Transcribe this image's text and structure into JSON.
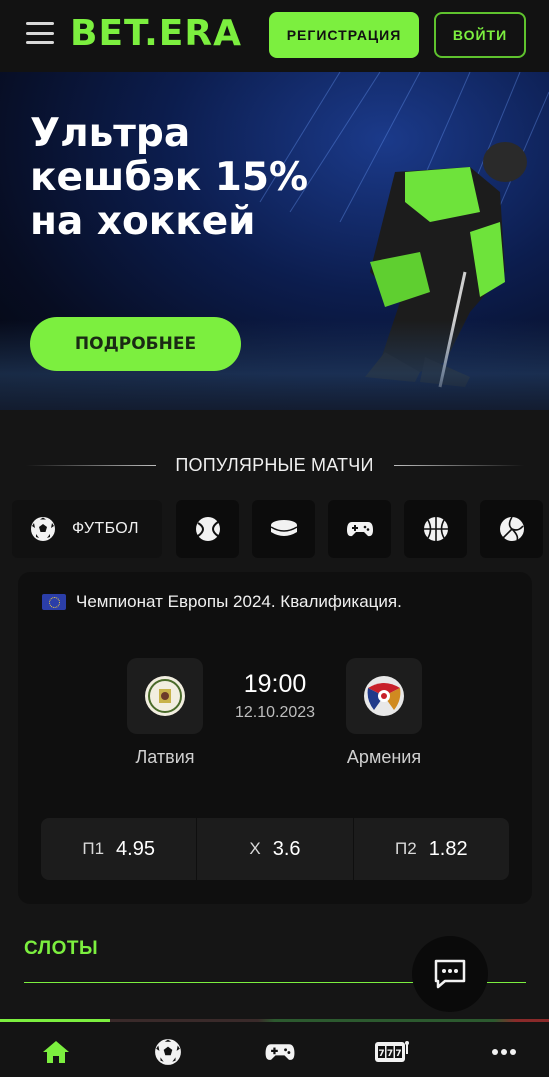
{
  "header": {
    "logo_text": "BET.ERA",
    "register_label": "РЕГИСТРАЦИЯ",
    "login_label": "ВОЙТИ",
    "accent_color": "#7cef3f"
  },
  "banner": {
    "title": "Ультра\nкешбэк 15%\nна хоккей",
    "button_label": "ПОДРОБНЕЕ"
  },
  "popular": {
    "title": "ПОПУЛЯРНЫЕ МАТЧИ",
    "tabs": [
      {
        "icon": "soccer-ball-icon",
        "label": "ФУТБОЛ",
        "active": true
      },
      {
        "icon": "tennis-ball-icon",
        "label": ""
      },
      {
        "icon": "hockey-puck-icon",
        "label": ""
      },
      {
        "icon": "gamepad-icon",
        "label": ""
      },
      {
        "icon": "basketball-icon",
        "label": ""
      },
      {
        "icon": "volleyball-icon",
        "label": ""
      }
    ]
  },
  "match": {
    "league": "Чемпионат Европы 2024. Квалификация.",
    "time": "19:00",
    "date": "12.10.2023",
    "home_team": "Латвия",
    "away_team": "Армения",
    "odds": [
      {
        "label": "П1",
        "value": "4.95"
      },
      {
        "label": "Х",
        "value": "3.6"
      },
      {
        "label": "П2",
        "value": "1.82"
      }
    ]
  },
  "slots": {
    "title": "СЛОТЫ"
  },
  "bottom_nav": [
    {
      "icon": "home-icon"
    },
    {
      "icon": "soccer-ball-icon"
    },
    {
      "icon": "gamepad-icon"
    },
    {
      "icon": "slot-machine-icon"
    },
    {
      "icon": "more-icon"
    }
  ]
}
